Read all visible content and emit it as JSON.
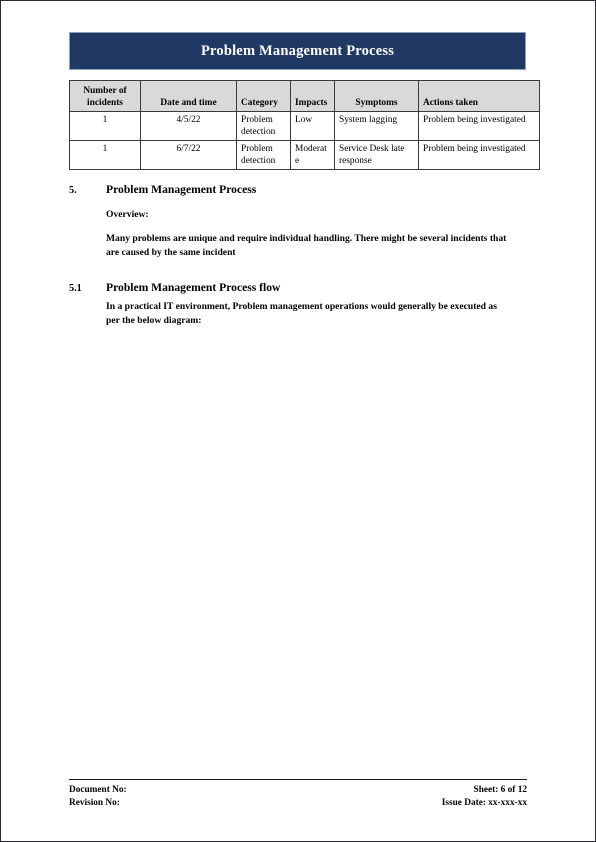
{
  "banner": {
    "title": "Problem Management Process",
    "background_color": "#1F3864",
    "text_color": "#FFFFFF"
  },
  "table": {
    "header_background": "#D9D9D9",
    "columns": [
      "Number of incidents",
      "Date and time",
      "Category",
      "Impacts",
      "Symptoms",
      "Actions taken"
    ],
    "rows": [
      {
        "number_of_incidents": "1",
        "date_and_time": "4/5/22",
        "category": "Problem detection",
        "impacts": "Low",
        "symptoms": "System lagging",
        "actions_taken": "Problem being investigated"
      },
      {
        "number_of_incidents": "1",
        "date_and_time": "6/7/22",
        "category": "Problem detection",
        "impacts": "Moderate",
        "symptoms": "Service Desk late response",
        "actions_taken": "Problem being investigated"
      }
    ]
  },
  "sections": [
    {
      "number": "5.",
      "title": "Problem Management Process",
      "subheading": "Overview:",
      "paragraph": "Many problems are unique and require individual handling. There might be several incidents that are caused by the same incident"
    },
    {
      "number": "5.1",
      "title": "Problem Management Process flow",
      "paragraph": "In a practical IT environment, Problem management operations would generally be executed as per the below diagram:"
    }
  ],
  "footer": {
    "document_no": "Document No:",
    "revision_no": "Revision No:",
    "sheet": "Sheet: 6 of 12",
    "issue_date": "Issue Date: xx-xxx-xx"
  }
}
